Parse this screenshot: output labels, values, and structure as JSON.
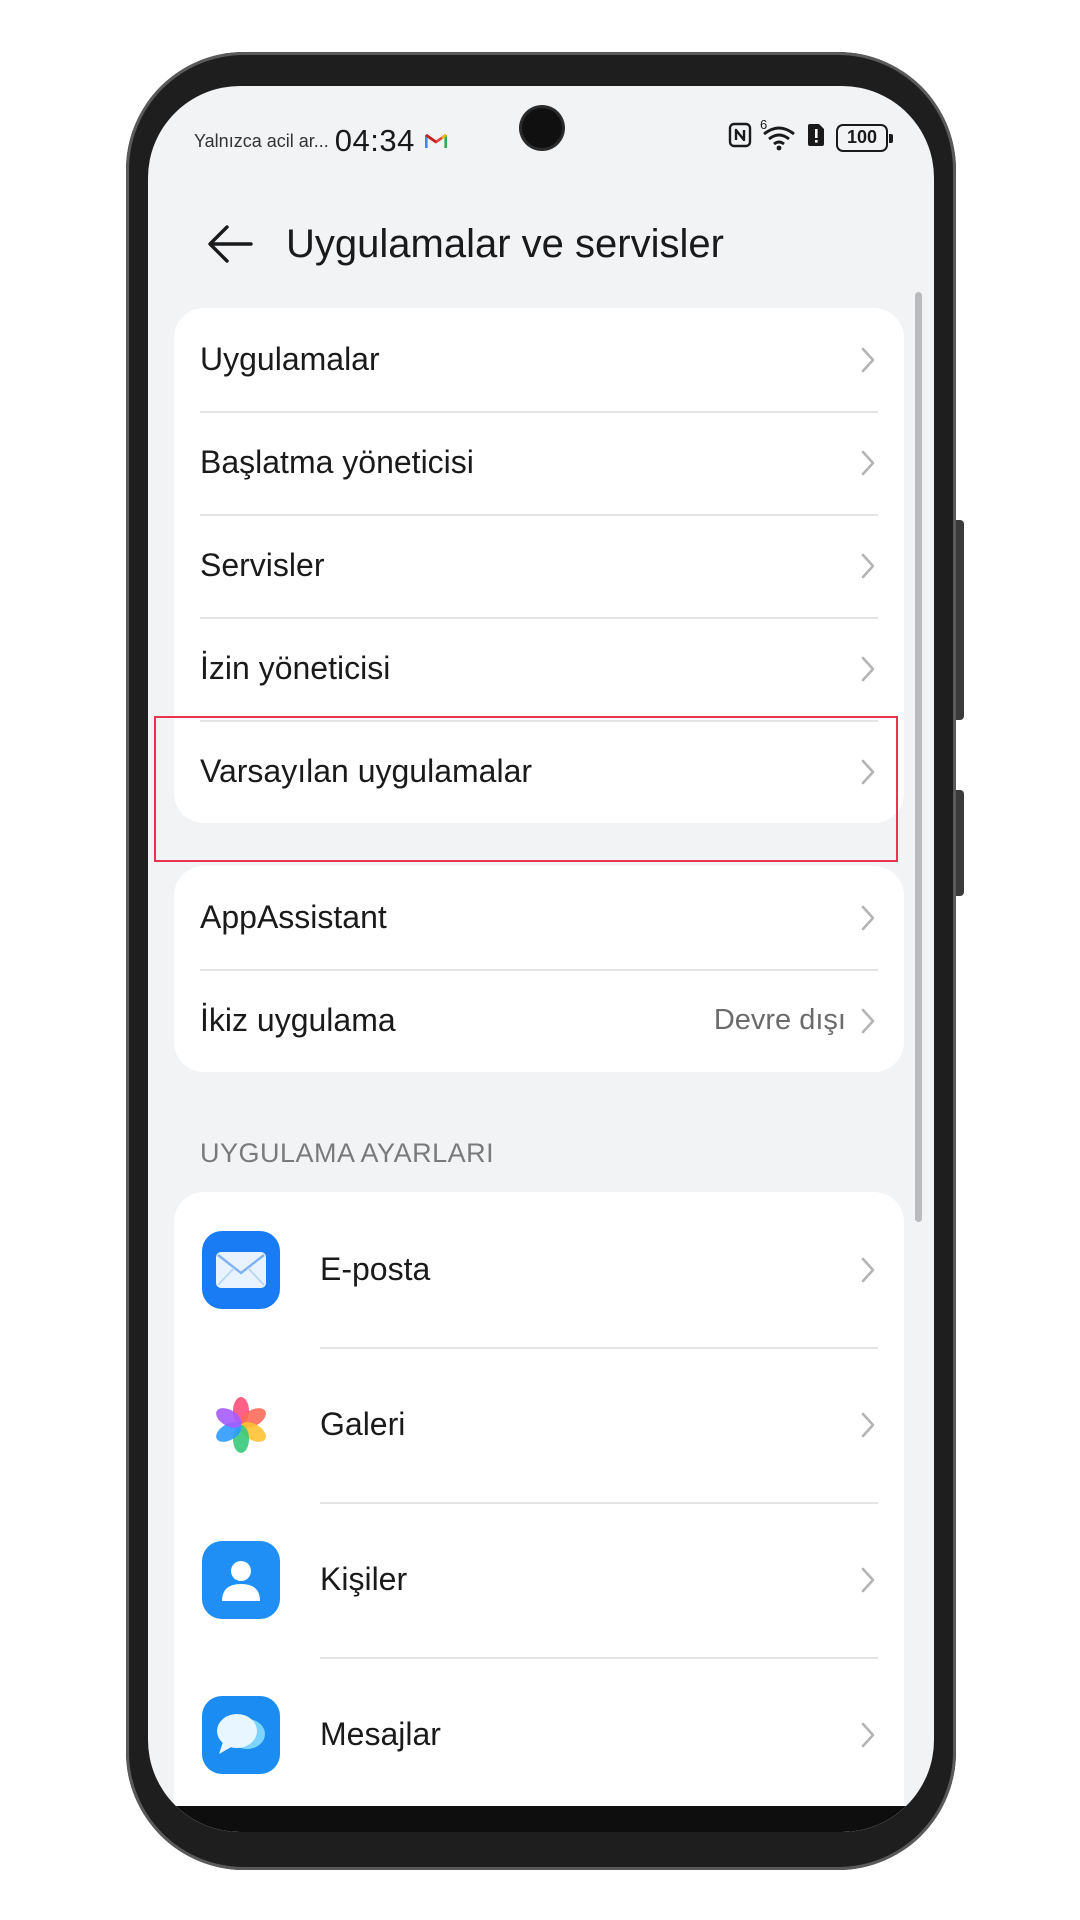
{
  "status_bar": {
    "notification_text": "Yalnızca acil ar...",
    "time": "04:34",
    "battery": "100",
    "network_badge": "6"
  },
  "header": {
    "title": "Uygulamalar ve servisler"
  },
  "group1": {
    "items": [
      {
        "label": "Uygulamalar"
      },
      {
        "label": "Başlatma yöneticisi"
      },
      {
        "label": "Servisler"
      },
      {
        "label": "İzin yöneticisi"
      },
      {
        "label": "Varsayılan uygulamalar"
      }
    ]
  },
  "group2": {
    "items": [
      {
        "label": "AppAssistant",
        "value": ""
      },
      {
        "label": "İkiz uygulama",
        "value": "Devre dışı"
      }
    ]
  },
  "app_settings": {
    "section_title": "UYGULAMA AYARLARI",
    "items": [
      {
        "label": "E-posta",
        "icon": "mail-app-icon"
      },
      {
        "label": "Galeri",
        "icon": "gallery-app-icon"
      },
      {
        "label": "Kişiler",
        "icon": "contacts-app-icon"
      },
      {
        "label": "Mesajlar",
        "icon": "messages-app-icon"
      }
    ]
  },
  "highlight": {
    "color": "#e8344e",
    "target": "Varsayılan uygulamalar"
  }
}
